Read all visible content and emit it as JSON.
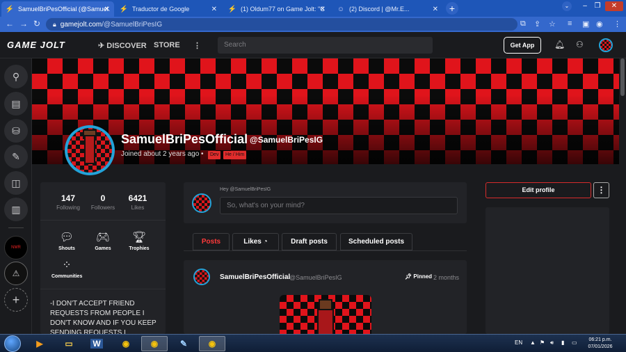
{
  "browser": {
    "tabs": [
      {
        "title": "SamuelBriPesOfficial (@Samuel...",
        "icon": "gamejolt-icon",
        "active": true
      },
      {
        "title": "Traductor de Google",
        "icon": "google-translate-icon",
        "active": false
      },
      {
        "title": "(1) Oldum77 on Game Jolt: \"Gam...",
        "icon": "gamejolt-icon",
        "active": false
      },
      {
        "title": "(2) Discord | @Mr.E...",
        "icon": "discord-icon",
        "active": false
      }
    ],
    "url_host": "gamejolt.com",
    "url_path": "/@SamuelBriPesIG"
  },
  "gj": {
    "logo": "GAME JOLT",
    "discover": "DISCOVER",
    "store": "STORE",
    "search_placeholder": "Search",
    "get_app": "Get App"
  },
  "profile": {
    "name": "SamuelBriPesOfficial",
    "handle": "@SamuelBriPesIG",
    "joined": "Joined about 2 years ago",
    "dot": "•",
    "tags": [
      "Dev",
      "He / Him"
    ],
    "stats": [
      {
        "value": "147",
        "label": "Following"
      },
      {
        "value": "0",
        "label": "Followers"
      },
      {
        "value": "6421",
        "label": "Likes"
      }
    ],
    "quick_links": [
      {
        "label": "Shouts",
        "icon": "shouts-icon"
      },
      {
        "label": "Games",
        "icon": "gamepad-icon"
      },
      {
        "label": "Trophies",
        "icon": "trophy-icon"
      },
      {
        "label": "Communities",
        "icon": "communities-icon"
      }
    ],
    "bio": "-I DON'T ACCEPT FRIEND REQUESTS FROM PEOPLE I DON'T KNOW AND IF YOU KEEP SENDING REQUESTS I"
  },
  "composer": {
    "greeting": "Hey @SamuelBriPesIG",
    "placeholder": "So, what's on your mind?"
  },
  "post_tabs": [
    "Posts",
    "Likes",
    "Draft posts",
    "Scheduled posts"
  ],
  "post": {
    "author": "SamuelBriPesOfficial",
    "handle": "@SamuelBriPesIG",
    "pinned": "Pinned",
    "time": "2 months"
  },
  "sidebar_right": {
    "edit_profile": "Edit profile"
  },
  "taskbar": {
    "lang": "EN",
    "time": "06:21 p.m.",
    "date": "07/01/2026"
  },
  "colors": {
    "accent_red": "#e0141b",
    "avatar_ring": "#23a3d9",
    "chrome_blue": "#1e56b8"
  }
}
